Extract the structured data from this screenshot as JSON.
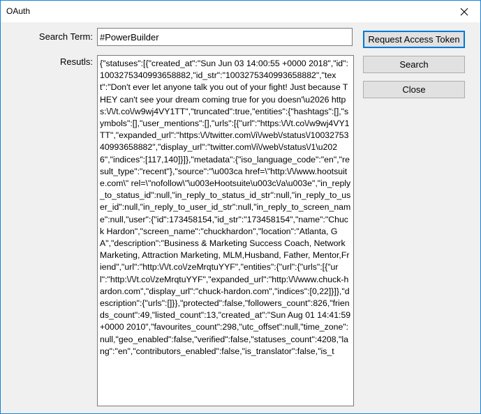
{
  "window": {
    "title": "OAuth"
  },
  "form": {
    "search_label": "Search Term:",
    "search_value": "#PowerBuilder",
    "results_label": "Resutls:",
    "results_text": "{\"statuses\":[{\"created_at\":\"Sun Jun 03 14:00:55 +0000 2018\",\"id\":1003275340993658882,\"id_str\":\"1003275340993658882\",\"text\":\"Don't ever let anyone talk you out of your fight! Just because THEY can't see your dream coming true for you doesn'\\u2026 https:\\/\\/t.co\\/w9wj4VY1TT\",\"truncated\":true,\"entities\":{\"hashtags\":[],\"symbols\":[],\"user_mentions\":[],\"urls\":[{\"url\":\"https:\\/\\/t.co\\/w9wj4VY1TT\",\"expanded_url\":\"https:\\/\\/twitter.com\\/i\\/web\\/status\\/1003275340993658882\",\"display_url\":\"twitter.com\\/i\\/web\\/status\\/1\\u2026\",\"indices\":[117,140]}]},\"metadata\":{\"iso_language_code\":\"en\",\"result_type\":\"recent\"},\"source\":\"\\u003ca href=\\\"http:\\/\\/www.hootsuite.com\\\" rel=\\\"nofollow\\\"\\u003eHootsuite\\u003c\\/a\\u003e\",\"in_reply_to_status_id\":null,\"in_reply_to_status_id_str\":null,\"in_reply_to_user_id\":null,\"in_reply_to_user_id_str\":null,\"in_reply_to_screen_name\":null,\"user\":{\"id\":173458154,\"id_str\":\"173458154\",\"name\":\"Chuck Hardon\",\"screen_name\":\"chuckhardon\",\"location\":\"Atlanta, GA\",\"description\":\"Business & Marketing Success Coach, Network Marketing, Attraction Marketing, MLM,Husband, Father, Mentor,Friend\",\"url\":\"http:\\/\\/t.co\\/zeMrqtuYYF\",\"entities\":{\"url\":{\"urls\":[{\"url\":\"http:\\/\\/t.co\\/zeMrqtuYYF\",\"expanded_url\":\"http:\\/\\/www.chuck-hardon.com\",\"display_url\":\"chuck-hardon.com\",\"indices\":[0,22]}]},\"description\":{\"urls\":[]}},\"protected\":false,\"followers_count\":826,\"friends_count\":49,\"listed_count\":13,\"created_at\":\"Sun Aug 01 14:41:59 +0000 2010\",\"favourites_count\":298,\"utc_offset\":null,\"time_zone\":null,\"geo_enabled\":false,\"verified\":false,\"statuses_count\":4208,\"lang\":\"en\",\"contributors_enabled\":false,\"is_translator\":false,\"is_t"
  },
  "buttons": {
    "request_token": "Request Access Token",
    "search": "Search",
    "close": "Close"
  },
  "icons": {
    "close": "close-icon"
  },
  "colors": {
    "window_border": "#1883d7",
    "dialog_bg": "#f0f0f0",
    "button_bg": "#e1e1e1",
    "focus_accent": "#0078d7"
  }
}
